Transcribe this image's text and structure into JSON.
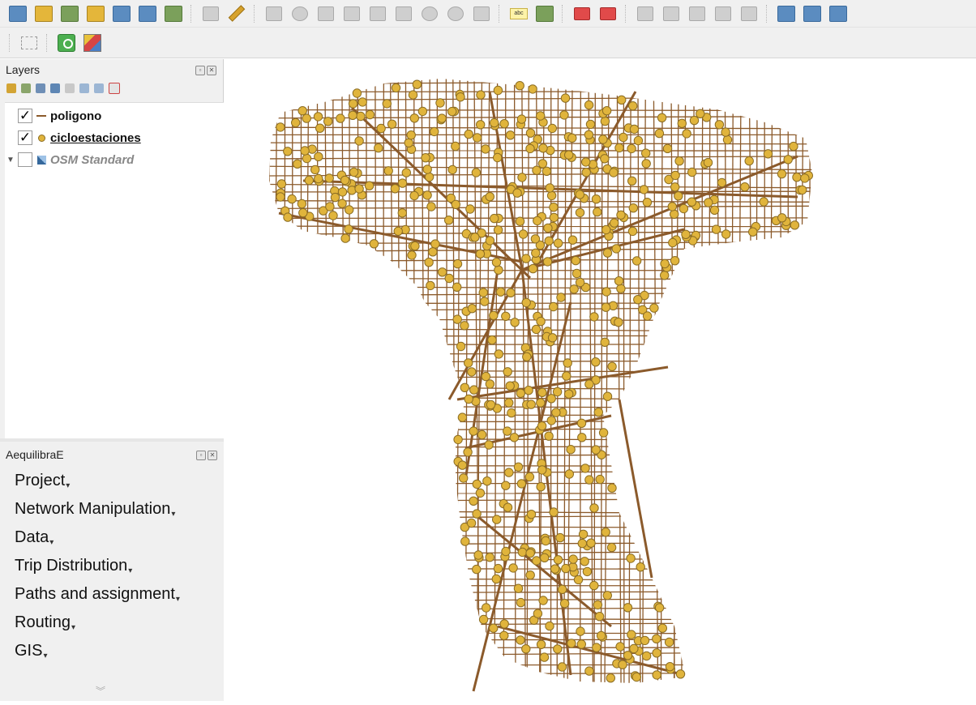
{
  "layers_panel": {
    "title": "Layers",
    "layers": [
      {
        "name": "poligono",
        "checked": true,
        "symbol": "line"
      },
      {
        "name": "cicloestaciones",
        "checked": true,
        "symbol": "point"
      },
      {
        "name": "OSM Standard",
        "checked": false,
        "symbol": "raster-tile"
      }
    ]
  },
  "aequilibrae_panel": {
    "title": "AequilibraE",
    "menu": [
      "Project",
      "Network Manipulation",
      "Data",
      "Trip Distribution",
      "Paths and assignment",
      "Routing",
      "GIS"
    ]
  },
  "map": {
    "network_color": "#8b5a2b",
    "station_fill": "#e0b43c",
    "station_stroke": "#8b6d24"
  },
  "icons": {
    "toolbar1": [
      "open-layer-icon",
      "add-layer-icon",
      "vertex-tool-icon",
      "edit-layer-icon",
      "digitize-icon",
      "table-icon",
      "attribute-icon",
      "pencil-icon",
      "node-tool-icon",
      "line-icon",
      "add-point-icon",
      "delete-icon",
      "cut-icon",
      "copy-icon",
      "paste-icon",
      "undo-icon",
      "redo-icon",
      "label-icon",
      "label-pin-icon",
      "label-red-icon",
      "label-show-icon",
      "label-move-icon",
      "label-rotate-icon",
      "label-change-icon",
      "label-style-icon",
      "plugin-a-icon",
      "plugin-b-icon",
      "plugin-c-icon"
    ],
    "toolbar2": [
      "select-tool-icon",
      "identify-icon",
      "multi-tool-icon"
    ]
  }
}
